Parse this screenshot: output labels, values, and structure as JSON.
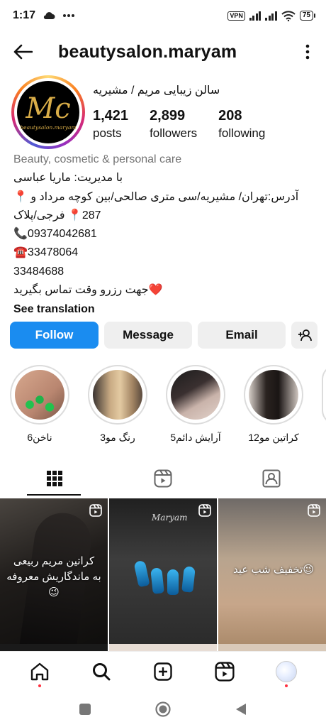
{
  "status_bar": {
    "time": "1:17",
    "vpn": "VPN",
    "battery": "75"
  },
  "header": {
    "username": "beautysalon.maryam"
  },
  "profile": {
    "display_name": "سالن زیبایی مریم / مشیریه",
    "avatar_monogram": "Mc",
    "avatar_script": "beautysalon.maryam",
    "stats": [
      {
        "value": "1,421",
        "label": "posts"
      },
      {
        "value": "2,899",
        "label": "followers"
      },
      {
        "value": "208",
        "label": "following"
      }
    ]
  },
  "bio": {
    "category": "Beauty, cosmetic & personal care",
    "lines": [
      "با مدیریت: ماریا عباسی",
      "آدرس:تهران/ مشیریه/سی متری صالحی/بین کوچه مرداد و 📍",
      "287📍 فرجی/پلاک",
      "📞09374042681",
      "☎️33478064",
      "33484688",
      "❤️جهت رزرو وقت تماس بگیرید"
    ],
    "see_translation": "See translation"
  },
  "actions": {
    "follow": "Follow",
    "message": "Message",
    "email": "Email"
  },
  "highlights": [
    {
      "label": "ناخن6"
    },
    {
      "label": "رنگ مو3"
    },
    {
      "label": "آرایش دائم5"
    },
    {
      "label": "کراتین مو12"
    }
  ],
  "posts": [
    {
      "caption": "کراتین مریم ربیعی\nبه ماندگاریش معروفه 😉"
    },
    {
      "caption": "Maryam"
    },
    {
      "caption": "😉تخفیف شب عید"
    }
  ],
  "colors": {
    "follow_blue": "#1a8cf0",
    "button_gray": "#efefef",
    "notification_red": "#ff3040"
  }
}
